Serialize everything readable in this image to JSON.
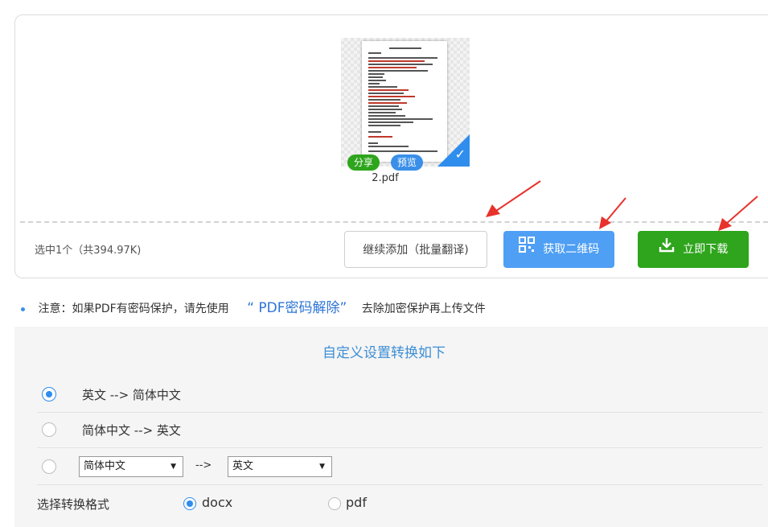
{
  "upload": {
    "file_name": "2.pdf",
    "share_label": "分享",
    "preview_label": "预览",
    "selected_info": "选中1个（共394.97K)",
    "add_more_label": "继续添加（批量翻译)",
    "qr_label": "获取二维码",
    "download_label": "立即下载"
  },
  "note": {
    "prefix": "注意：如果PDF有密码保护，请先使用",
    "link": "“ PDF密码解除”",
    "suffix": "去除加密保护再上传文件"
  },
  "settings": {
    "title": "自定义设置转换如下",
    "options": [
      {
        "label": "英文 --> 简体中文",
        "selected": true
      },
      {
        "label": "简体中文 --> 英文",
        "selected": false
      }
    ],
    "custom": {
      "source": "简体中文",
      "arrow": "-->",
      "target": "英文",
      "selected": false
    },
    "format": {
      "label": "选择转换格式",
      "options": [
        {
          "label": "docx",
          "selected": true
        },
        {
          "label": "pdf",
          "selected": false
        }
      ]
    }
  },
  "colors": {
    "accent_blue": "#4f9ff4",
    "accent_green": "#2ea51c",
    "title_blue": "#3d8fd6",
    "arrow_red": "#e8322c"
  }
}
